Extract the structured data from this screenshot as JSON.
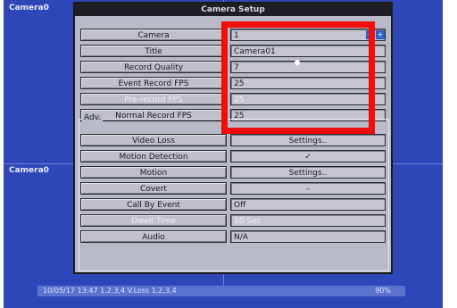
{
  "overlay": {
    "camera_labels": [
      "Camera0",
      "Camera0"
    ],
    "status": {
      "left": "10/05/17 13:47   1,2,3,4   V.Loss 1,2,3,4",
      "right": "90%"
    }
  },
  "dialog": {
    "title": "Camera Setup",
    "rows": [
      {
        "label": "Camera",
        "value": "1"
      },
      {
        "label": "Title",
        "value": "Camera01"
      },
      {
        "label": "Record Quality",
        "value": "7"
      },
      {
        "label": "Event Record FPS",
        "value": "25"
      },
      {
        "label": "Pre-record FPS",
        "value": "25"
      },
      {
        "label": "Normal Record FPS",
        "value": "25"
      }
    ],
    "adv_title": "Adv.",
    "adv_rows": [
      {
        "label": "Video Loss",
        "value": "Settings.."
      },
      {
        "label": "Motion Detection",
        "value": "✓"
      },
      {
        "label": "Motion",
        "value": "Settings.."
      },
      {
        "label": "Covert",
        "value": "–"
      },
      {
        "label": "Call By Event",
        "value": "Off"
      },
      {
        "label": "Dwell Time",
        "value": "10 Sec"
      },
      {
        "label": "Audio",
        "value": "N/A"
      }
    ]
  },
  "colors": {
    "highlight_box": "#f20d0d",
    "screen_bg": "#2e47b8"
  }
}
